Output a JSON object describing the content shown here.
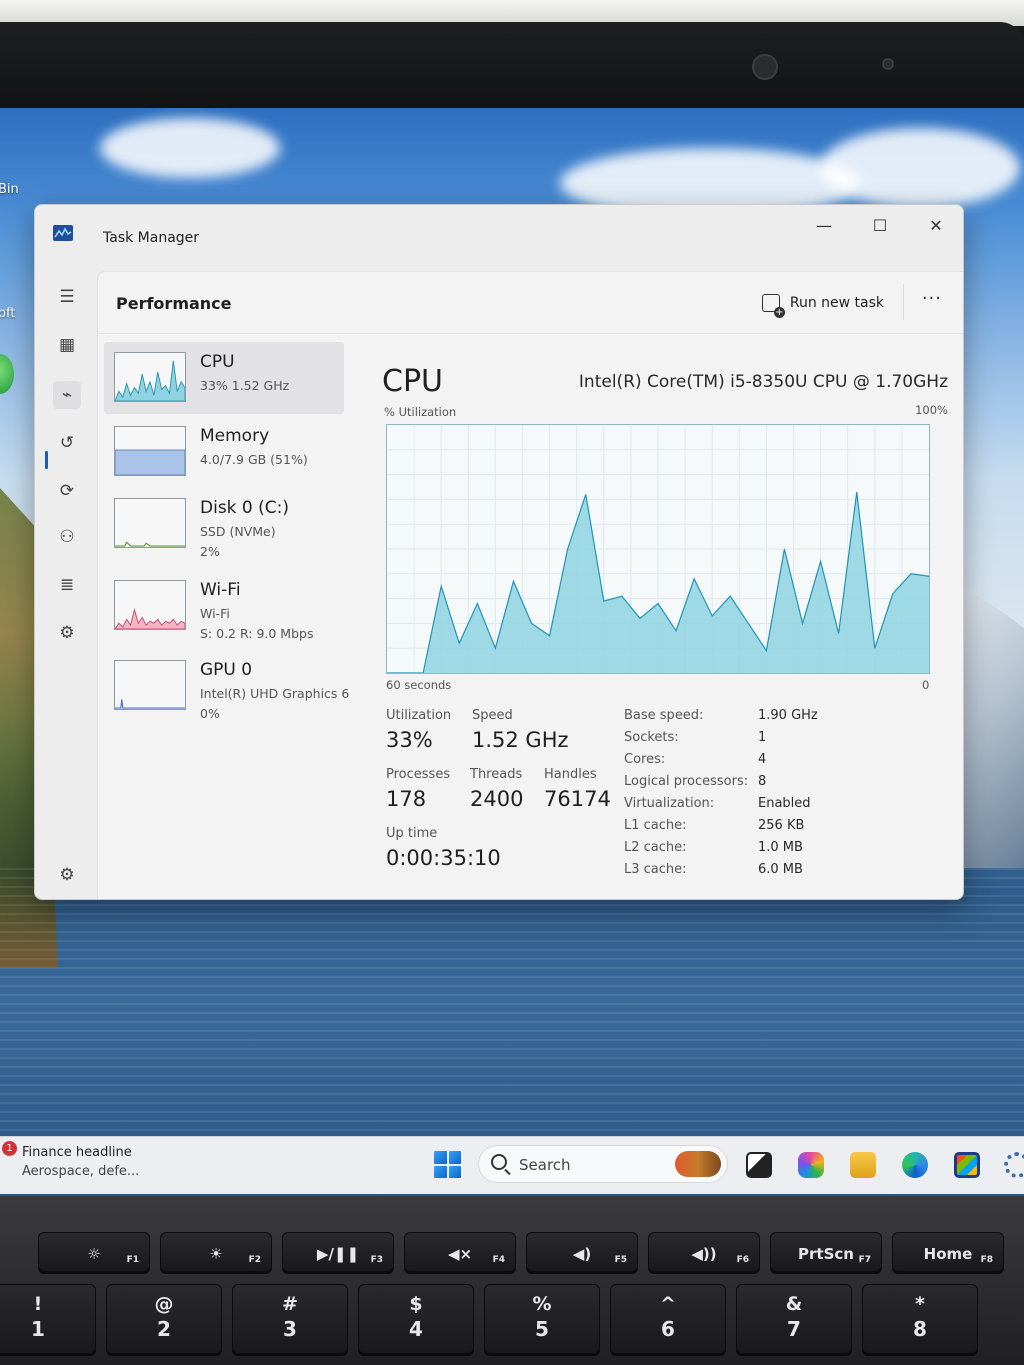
{
  "desktop": {
    "label_bin": "Bin",
    "label_oft": "oft"
  },
  "window": {
    "title": "Task Manager",
    "minimize": "—",
    "maximize": "☐",
    "close": "✕"
  },
  "nav": {
    "items": [
      {
        "name": "hamburger-menu-icon",
        "glyph": "☰"
      },
      {
        "name": "processes-icon",
        "glyph": "▦"
      },
      {
        "name": "performance-icon",
        "glyph": "⌁"
      },
      {
        "name": "app-history-icon",
        "glyph": "↺"
      },
      {
        "name": "startup-apps-icon",
        "glyph": "⟳"
      },
      {
        "name": "users-icon",
        "glyph": "⚇"
      },
      {
        "name": "details-icon",
        "glyph": "≣"
      },
      {
        "name": "services-icon",
        "glyph": "⚙"
      }
    ],
    "settings_glyph": "⚙"
  },
  "header": {
    "title": "Performance",
    "run_new_task": "Run new task",
    "more": "···"
  },
  "resources": [
    {
      "name": "CPU",
      "sub1": "33%  1.52 GHz",
      "sub2": ""
    },
    {
      "name": "Memory",
      "sub1": "4.0/7.9 GB (51%)",
      "sub2": ""
    },
    {
      "name": "Disk 0 (C:)",
      "sub1": "SSD (NVMe)",
      "sub2": "2%"
    },
    {
      "name": "Wi-Fi",
      "sub1": "Wi-Fi",
      "sub2": "S: 0.2  R: 9.0 Mbps"
    },
    {
      "name": "GPU 0",
      "sub1": "Intel(R) UHD Graphics 6",
      "sub2": "0%"
    }
  ],
  "detail": {
    "title": "CPU",
    "model": "Intel(R) Core(TM) i5-8350U CPU @ 1.70GHz",
    "y_label": "% Utilization",
    "y_max_label": "100%",
    "x_left_label": "60 seconds",
    "x_right_label": "0",
    "stats": {
      "utilization_label": "Utilization",
      "utilization": "33%",
      "speed_label": "Speed",
      "speed": "1.52 GHz",
      "processes_label": "Processes",
      "processes": "178",
      "threads_label": "Threads",
      "threads": "2400",
      "handles_label": "Handles",
      "handles": "76174",
      "uptime_label": "Up time",
      "uptime": "0:00:35:10"
    },
    "specs": [
      {
        "k": "Base speed:",
        "v": "1.90 GHz"
      },
      {
        "k": "Sockets:",
        "v": "1"
      },
      {
        "k": "Cores:",
        "v": "4"
      },
      {
        "k": "Logical processors:",
        "v": "8"
      },
      {
        "k": "Virtualization:",
        "v": "Enabled"
      },
      {
        "k": "L1 cache:",
        "v": "256 KB"
      },
      {
        "k": "L2 cache:",
        "v": "1.0 MB"
      },
      {
        "k": "L3 cache:",
        "v": "6.0 MB"
      }
    ]
  },
  "chart_data": {
    "type": "area",
    "x": [
      60,
      58,
      56,
      54,
      52,
      50,
      48,
      46,
      44,
      42,
      40,
      38,
      36,
      34,
      32,
      30,
      28,
      26,
      24,
      22,
      20,
      18,
      16,
      14,
      12,
      10,
      8,
      6,
      4,
      2,
      0
    ],
    "series": [
      {
        "values": [
          0,
          0,
          0,
          35,
          12,
          28,
          10,
          37,
          20,
          15,
          50,
          72,
          29,
          31,
          22,
          28,
          17,
          38,
          23,
          31,
          20,
          9,
          50,
          20,
          45,
          16,
          73,
          10,
          32,
          40,
          39
        ]
      }
    ],
    "ylim": [
      0,
      100
    ],
    "xlim": [
      60,
      0
    ],
    "color": "#8fd3e2"
  },
  "taskbar": {
    "news_badge": "1",
    "news_title": "Finance headline",
    "news_sub": "Aerospace, defe...",
    "search_placeholder": "Search"
  },
  "keyboard": {
    "fn_keys": [
      {
        "main": "☼",
        "fn": "F1"
      },
      {
        "main": "☀",
        "fn": "F2"
      },
      {
        "main": "▶/❚❚",
        "fn": "F3"
      },
      {
        "main": "◀×",
        "fn": "F4"
      },
      {
        "main": "◀)",
        "fn": "F5"
      },
      {
        "main": "◀))",
        "fn": "F6"
      },
      {
        "main": "PrtScn",
        "fn": "F7"
      },
      {
        "main": "Home",
        "fn": "F8"
      }
    ],
    "num_keys": [
      {
        "top": "!",
        "bot": "1"
      },
      {
        "top": "@",
        "bot": "2"
      },
      {
        "top": "#",
        "bot": "3"
      },
      {
        "top": "$",
        "bot": "4"
      },
      {
        "top": "%",
        "bot": "5"
      },
      {
        "top": "^",
        "bot": "6"
      },
      {
        "top": "&",
        "bot": "7"
      },
      {
        "top": "*",
        "bot": "8"
      }
    ]
  }
}
